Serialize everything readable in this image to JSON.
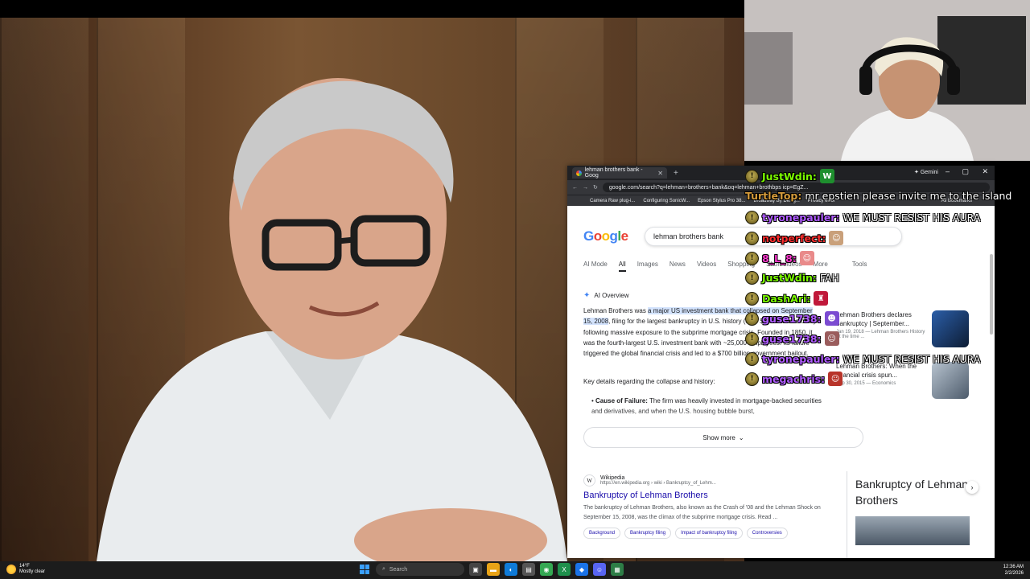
{
  "browser": {
    "tab_title": "lehman brothers bank - Goog",
    "new_tab_icon": "plus-icon",
    "gemini_label": "Gemini",
    "url": "google.com/search?q=lehman+brothers+bank&oq=lehman+brothbps icp=EgZ...",
    "bookmarks": [
      "Camera Raw plug-i...",
      "Configuring SonicW...",
      "Epson Stylus Pro 38...",
      "Broadway By Desig...",
      "Privacy error"
    ],
    "all_bookmarks": "All Bookmarks"
  },
  "google": {
    "query": "lehman brothers bank",
    "tabs": [
      "AI Mode",
      "All",
      "Images",
      "News",
      "Videos",
      "Shopping",
      "Short videos",
      "More",
      "Tools"
    ],
    "ai_overview_label": "AI Overview",
    "ai_text_pre": "Lehman Brothers was ",
    "ai_text_hl": "a major US investment bank that collapsed on September 15, 2008",
    "ai_text_post": ", filing for the largest bankruptcy in U.S. history (over $600 billion in debt) following massive exposure to the subprime mortgage crisis. Founded in 1850, it was the fourth-largest U.S. investment bank with ~25,000 employees. Its failure triggered the global financial crisis and led to a $700 billion government bailout.",
    "key_details": "Key details regarding the collapse and history:",
    "bullet_label": "Cause of Failure:",
    "bullet_text": "The firm was heavily invested in mortgage-backed securities and derivatives, and when the U.S. housing bubble burst,",
    "show_more": "Show more",
    "side_results": [
      {
        "title": "Lehman Brothers declares bankruptcy | September...",
        "meta": "Jan 19, 2018 — Lehman Brothers History At the time ..."
      },
      {
        "title": "Lehman Brothers: When the financial crisis spun...",
        "meta": "Sep 30, 2015 — Economics"
      }
    ],
    "wiki": {
      "site": "Wikipedia",
      "link": "https://en.wikipedia.org › wiki › Bankruptcy_of_Lehm...",
      "title": "Bankruptcy of Lehman Brothers",
      "snippet": "The bankruptcy of Lehman Brothers, also known as the Crash of '08 and the Lehman Shock on September 15, 2008, was the climax of the subprime mortgage crisis. Read ...",
      "chips": [
        "Background",
        "Bankruptcy filing",
        "Impact of bankruptcy filing",
        "Controversies"
      ]
    },
    "knowledge_panel_title": "Bankruptcy of Lehman Brothers"
  },
  "chat": [
    {
      "user": "JustWdin:",
      "color": "#7CFC00",
      "text": "",
      "emote": "W",
      "emote_bg": "#1e8f2e"
    },
    {
      "user": "TurtleTop:",
      "color": "#d39a3a",
      "text": "mr epstien please invite me to the island",
      "emote": "",
      "emote_bg": ""
    },
    {
      "user": "tyronepauler:",
      "color": "#b05cff",
      "text": "WE MUST RESIST HIS AURA",
      "emote": "",
      "emote_bg": ""
    },
    {
      "user": "notperfect:",
      "color": "#ff2d2d",
      "text": "",
      "emote": "☺",
      "emote_bg": "#c9a07a"
    },
    {
      "user": "8_L_8:",
      "color": "#ff3ad1",
      "text": "",
      "emote": "☺",
      "emote_bg": "#e98a8a"
    },
    {
      "user": "JustWdin:",
      "color": "#7CFC00",
      "text": "FAH",
      "emote": "",
      "emote_bg": ""
    },
    {
      "user": "DashAri:",
      "color": "#7CFC00",
      "text": "",
      "emote": "♜",
      "emote_bg": "#c0183a"
    },
    {
      "user": "guse1738:",
      "color": "#b05cff",
      "text": "",
      "emote": "☻",
      "emote_bg": "#7b4bd1"
    },
    {
      "user": "guse1738:",
      "color": "#b05cff",
      "text": "",
      "emote": "☺",
      "emote_bg": "#9a5c5c"
    },
    {
      "user": "tyronepauler:",
      "color": "#b05cff",
      "text": "WE MUST RESIST HIS AURA",
      "emote": "",
      "emote_bg": ""
    },
    {
      "user": "megachris:",
      "color": "#b05cff",
      "text": "",
      "emote": "☺",
      "emote_bg": "#b8342a"
    }
  ],
  "taskbar": {
    "temp": "14°F",
    "weather": "Mostly clear",
    "search": "Search",
    "time": "12:36 AM",
    "date": "2/2/2026"
  }
}
